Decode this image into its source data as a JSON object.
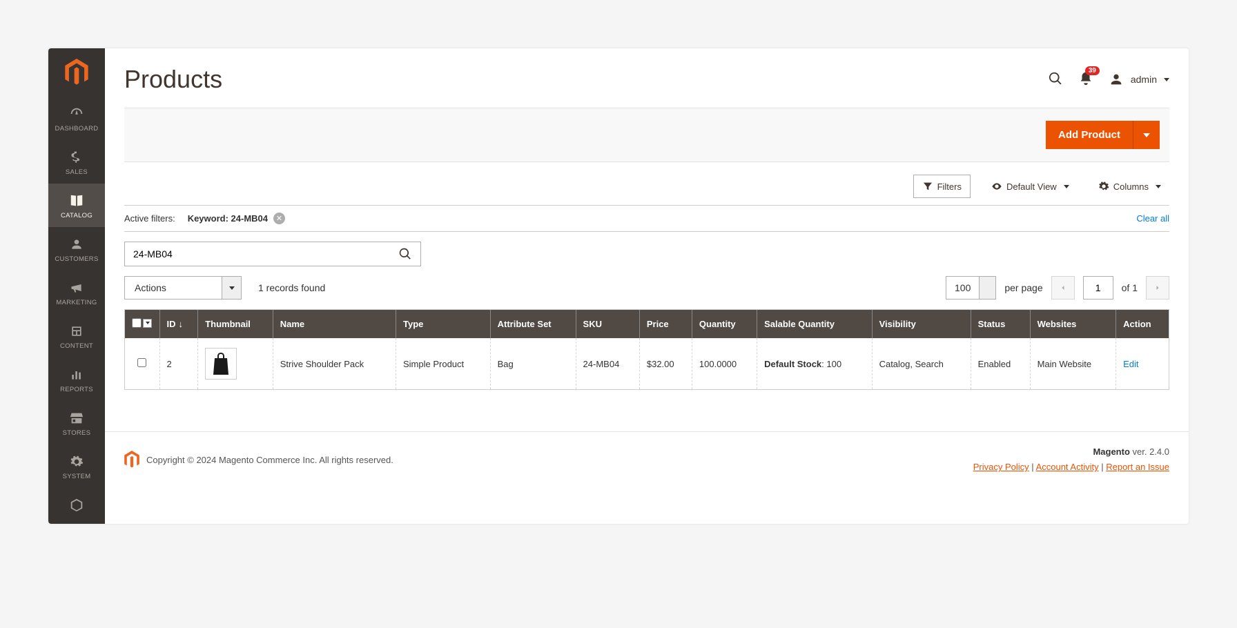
{
  "sidebar": {
    "items": [
      {
        "label": "Dashboard"
      },
      {
        "label": "Sales"
      },
      {
        "label": "Catalog"
      },
      {
        "label": "Customers"
      },
      {
        "label": "Marketing"
      },
      {
        "label": "Content"
      },
      {
        "label": "Reports"
      },
      {
        "label": "Stores"
      },
      {
        "label": "System"
      }
    ]
  },
  "header": {
    "title": "Products",
    "notifications": "39",
    "user": "admin"
  },
  "actionbar": {
    "add_product": "Add Product"
  },
  "toolbar": {
    "filters": "Filters",
    "default_view": "Default View",
    "columns": "Columns"
  },
  "filters": {
    "label": "Active filters:",
    "keyword_label": "Keyword:",
    "keyword_value": "24-MB04",
    "clear_all": "Clear all"
  },
  "search": {
    "value": "24-MB04"
  },
  "gridctrl": {
    "actions": "Actions",
    "records": "1 records found",
    "perpage": "100",
    "perpage_label": "per page",
    "page": "1",
    "of": "of 1"
  },
  "columns": {
    "id": "ID",
    "thumbnail": "Thumbnail",
    "name": "Name",
    "type": "Type",
    "attrset": "Attribute Set",
    "sku": "SKU",
    "price": "Price",
    "qty": "Quantity",
    "salable": "Salable Quantity",
    "visibility": "Visibility",
    "status": "Status",
    "websites": "Websites",
    "action": "Action"
  },
  "row": {
    "id": "2",
    "name": "Strive Shoulder Pack",
    "type": "Simple Product",
    "attrset": "Bag",
    "sku": "24-MB04",
    "price": "$32.00",
    "qty": "100.0000",
    "salable_label": "Default Stock",
    "salable_value": ": 100",
    "visibility": "Catalog, Search",
    "status": "Enabled",
    "websites": "Main Website",
    "edit": "Edit"
  },
  "footer": {
    "copyright": "Copyright © 2024 Magento Commerce Inc. All rights reserved.",
    "magento": "Magento",
    "version": " ver. 2.4.0",
    "privacy": "Privacy Policy",
    "activity": " Account Activity",
    "report": "Report an Issue"
  }
}
